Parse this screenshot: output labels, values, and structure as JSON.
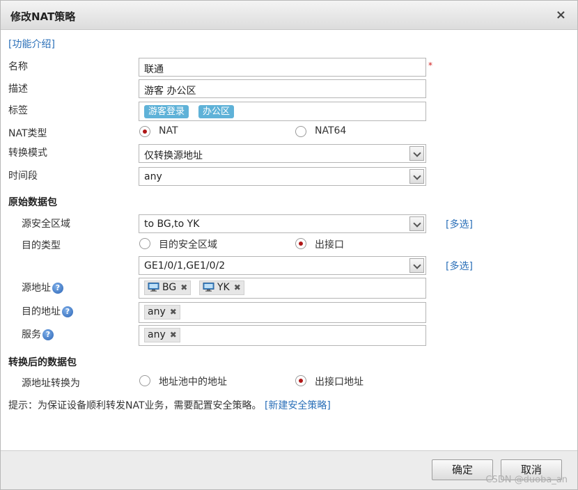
{
  "dialog": {
    "title": "修改NAT策略",
    "close_label": "×"
  },
  "intro_link": "[功能介绍]",
  "fields": {
    "name": {
      "label": "名称",
      "value": "联通"
    },
    "description": {
      "label": "描述",
      "value": "游客 办公区"
    },
    "tags": {
      "label": "标签",
      "items": [
        "游客登录",
        "办公区"
      ]
    },
    "nat_type": {
      "label": "NAT类型",
      "options": [
        "NAT",
        "NAT64"
      ],
      "selected": "NAT"
    },
    "mode": {
      "label": "转换模式",
      "value": "仅转换源地址"
    },
    "time_range": {
      "label": "时间段",
      "value": "any"
    }
  },
  "original_packet": {
    "heading": "原始数据包",
    "source_zone": {
      "label": "源安全区域",
      "value": "to BG,to YK",
      "multi_link": "[多选]"
    },
    "dest_type": {
      "label": "目的类型",
      "options": [
        "目的安全区域",
        "出接口"
      ],
      "selected": "出接口"
    },
    "egress": {
      "value": "GE1/0/1,GE1/0/2",
      "multi_link": "[多选]"
    },
    "source_address": {
      "label": "源地址",
      "help": "?",
      "items": [
        "BG",
        "YK"
      ]
    },
    "dest_address": {
      "label": "目的地址",
      "help": "?",
      "items": [
        "any"
      ]
    },
    "service": {
      "label": "服务",
      "help": "?",
      "items": [
        "any"
      ]
    }
  },
  "translated_packet": {
    "heading": "转换后的数据包",
    "source_translate": {
      "label": "源地址转换为",
      "options": [
        "地址池中的地址",
        "出接口地址"
      ],
      "selected": "出接口地址"
    }
  },
  "hint": {
    "text": "提示：为保证设备顺利转发NAT业务，需要配置安全策略。",
    "link": "[新建安全策略]"
  },
  "buttons": {
    "ok": "确定",
    "cancel": "取消"
  },
  "watermark": "CSDN @duoba_an",
  "required_mark": "*",
  "chip_remove": "✖",
  "colors": {
    "link": "#2a6fb8",
    "tag": "#5fb2d8",
    "radio_selected": "#b01818",
    "required": "#d02020"
  }
}
